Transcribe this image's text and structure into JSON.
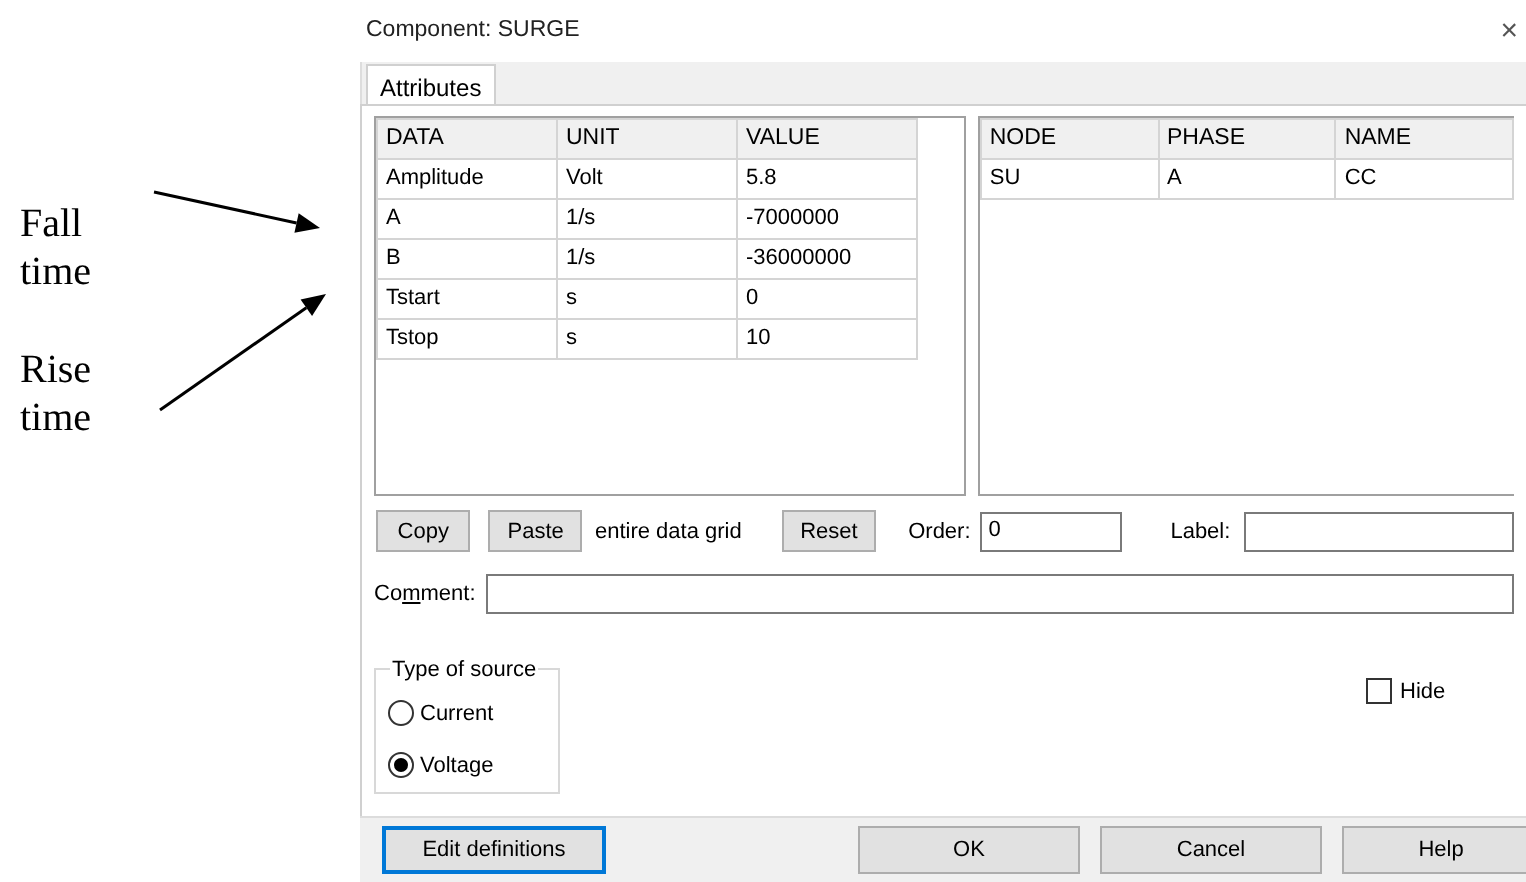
{
  "annotations": [
    {
      "text": "Fall time",
      "kind": "fall"
    },
    {
      "text": "Rise time",
      "kind": "rise"
    }
  ],
  "window": {
    "title": "Component: SURGE",
    "close": "×"
  },
  "tabs": [
    {
      "label": "Attributes",
      "selected": true
    }
  ],
  "data_grid": {
    "columns": [
      "DATA",
      "UNIT",
      "VALUE"
    ],
    "rows": [
      [
        "Amplitude",
        "Volt",
        "5.8"
      ],
      [
        "A",
        "1/s",
        "-7000000"
      ],
      [
        "B",
        "1/s",
        "-36000000"
      ],
      [
        "Tstart",
        "s",
        "0"
      ],
      [
        "Tstop",
        "s",
        "10"
      ]
    ]
  },
  "node_grid": {
    "columns": [
      "NODE",
      "PHASE",
      "NAME"
    ],
    "rows": [
      [
        "SU",
        "A",
        "CC"
      ]
    ]
  },
  "grid_buttons": [
    "Copy",
    "Paste"
  ],
  "grid_note": "entire data grid",
  "reset_button": "Reset",
  "order": {
    "label": "Order:",
    "value": "0"
  },
  "label_field": {
    "label": "Label:"
  },
  "comment": {
    "label_parts": [
      {
        "text": "Co",
        "underline": false
      },
      {
        "text": "m",
        "underline": true
      },
      {
        "text": "ment:",
        "underline": false
      }
    ]
  },
  "type_of_source": {
    "label": "Type of source",
    "options": [
      {
        "label": "Current",
        "selected": false
      },
      {
        "label": "Voltage",
        "selected": true
      }
    ]
  },
  "hide": {
    "label": "Hide",
    "checked": false
  },
  "footer_buttons": [
    {
      "label": "Edit definitions",
      "focused": true
    },
    {
      "label": "OK",
      "focused": false
    },
    {
      "label": "Cancel",
      "focused": false
    },
    {
      "label": "Help",
      "focused": false
    }
  ]
}
